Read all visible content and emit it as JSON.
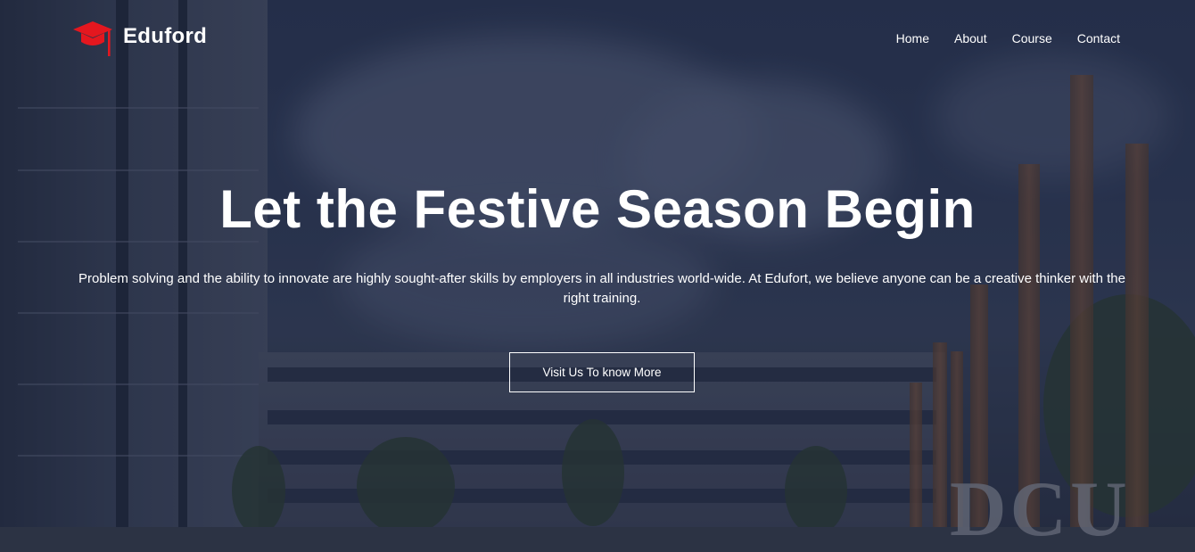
{
  "brand": {
    "name": "Eduford",
    "logo_icon": "graduation-cap-icon",
    "accent_color": "#e4171f"
  },
  "nav": {
    "items": [
      {
        "label": "Home"
      },
      {
        "label": "About"
      },
      {
        "label": "Course"
      },
      {
        "label": "Contact"
      }
    ]
  },
  "hero": {
    "headline": "Let the Festive Season Begin",
    "subtext": "Problem solving and the ability to innovate are highly sought-after skills by employers in all industries world-wide. At Edufort, we believe anyone can be a creative thinker with the right training.",
    "cta_label": "Visit Us To know More",
    "background_sign": "DCU"
  }
}
